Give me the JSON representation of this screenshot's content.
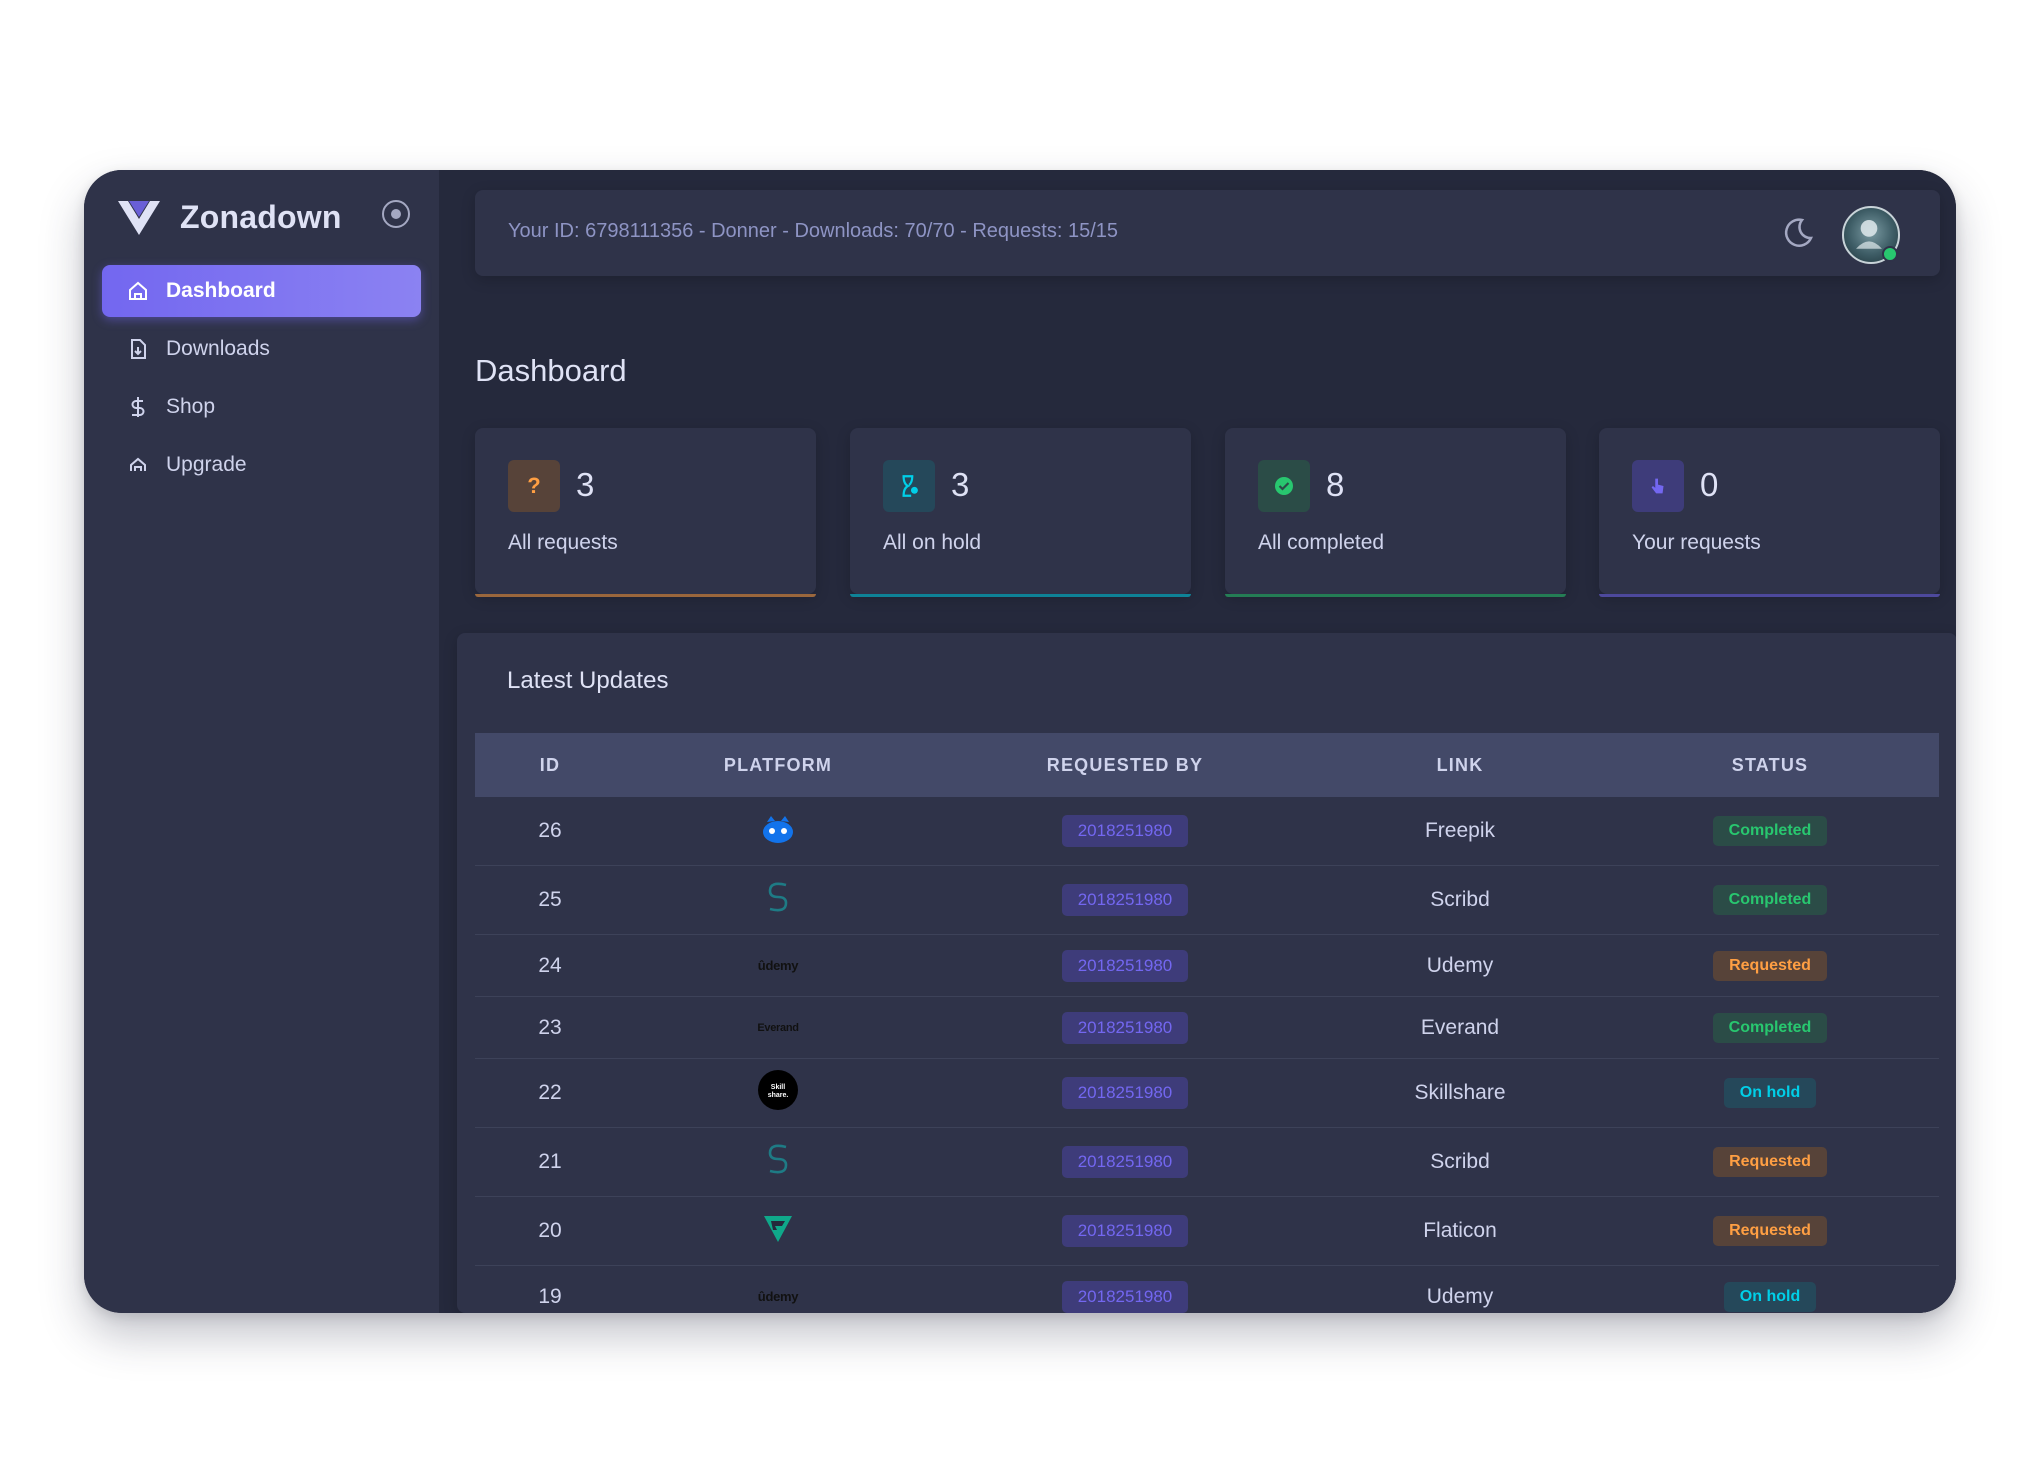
{
  "brand": {
    "name": "Zonadown",
    "logo_icon": "zonadown-logo-icon"
  },
  "sidebar": {
    "items": [
      {
        "label": "Dashboard",
        "icon": "home-icon",
        "active": true
      },
      {
        "label": "Downloads",
        "icon": "file-download-icon",
        "active": false
      },
      {
        "label": "Shop",
        "icon": "dollar-icon",
        "active": false
      },
      {
        "label": "Upgrade",
        "icon": "arrow-up-icon",
        "active": false
      }
    ]
  },
  "topbar": {
    "info": "Your ID: 6798111356 - Donner - Downloads: 70/70 - Requests: 15/15",
    "theme_icon": "moon-icon",
    "avatar_status": "online"
  },
  "page": {
    "title": "Dashboard"
  },
  "stats": [
    {
      "value": "3",
      "label": "All requests",
      "icon": "question-icon",
      "color": "#ff9f43"
    },
    {
      "value": "3",
      "label": "All on hold",
      "icon": "hourglass-icon",
      "color": "#00cfe8"
    },
    {
      "value": "8",
      "label": "All completed",
      "icon": "check-circle-icon",
      "color": "#28c76f"
    },
    {
      "value": "0",
      "label": "Your requests",
      "icon": "pointer-icon",
      "color": "#7367f0"
    }
  ],
  "updates": {
    "title": "Latest Updates",
    "columns": [
      "ID",
      "PLATFORM",
      "REQUESTED BY",
      "LINK",
      "STATUS"
    ],
    "rows": [
      {
        "id": "26",
        "platform": "freepik",
        "requested_by": "2018251980",
        "link": "Freepik",
        "status": "Completed"
      },
      {
        "id": "25",
        "platform": "scribd",
        "requested_by": "2018251980",
        "link": "Scribd",
        "status": "Completed"
      },
      {
        "id": "24",
        "platform": "udemy",
        "requested_by": "2018251980",
        "link": "Udemy",
        "status": "Requested"
      },
      {
        "id": "23",
        "platform": "everand",
        "requested_by": "2018251980",
        "link": "Everand",
        "status": "Completed"
      },
      {
        "id": "22",
        "platform": "skillshare",
        "requested_by": "2018251980",
        "link": "Skillshare",
        "status": "On hold"
      },
      {
        "id": "21",
        "platform": "scribd",
        "requested_by": "2018251980",
        "link": "Scribd",
        "status": "Requested"
      },
      {
        "id": "20",
        "platform": "flaticon",
        "requested_by": "2018251980",
        "link": "Flaticon",
        "status": "Requested"
      },
      {
        "id": "19",
        "platform": "udemy",
        "requested_by": "2018251980",
        "link": "Udemy",
        "status": "On hold"
      }
    ],
    "platform_logo_text": {
      "udemy": "ûdemy",
      "everand": "Everand",
      "skillshare": "Skill share."
    }
  },
  "colors": {
    "primary": "#7367f0",
    "success": "#28c76f",
    "warning": "#ff9f43",
    "info": "#00cfe8",
    "sidebar_bg": "#2f3349",
    "main_bg": "#25293c"
  }
}
